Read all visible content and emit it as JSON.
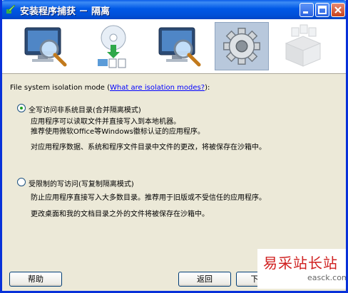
{
  "window": {
    "title": "安装程序捕获 － 隔离"
  },
  "steps": [
    {
      "name": "monitor-search",
      "active": false
    },
    {
      "name": "disc-install",
      "active": false
    },
    {
      "name": "monitor-search-2",
      "active": false
    },
    {
      "name": "settings-gear",
      "active": true
    },
    {
      "name": "package-box",
      "active": false
    }
  ],
  "isolation": {
    "heading_prefix": "File system isolation mode (",
    "heading_link": "What are isolation modes?",
    "heading_suffix": "):",
    "option1": {
      "label": "全写访问非系统目录(合并隔离模式)",
      "desc1": "应用程序可以读取文件并直接写入到本地机器。",
      "desc2": "推荐使用微软Office等Windows徽标认证的应用程序。",
      "desc3": "对应用程序数据、系统和程序文件目录中文件的更改，将被保存在沙箱中。",
      "selected": true
    },
    "option2": {
      "label": "受限制的写访问(写复制隔离模式)",
      "desc1": "防止应用程序直接写入大多数目录。推荐用于旧版或不受信任的应用程序。",
      "desc2": "更改桌面和我的文档目录之外的文件将被保存在沙箱中。",
      "selected": false
    }
  },
  "buttons": {
    "help": "帮助",
    "back": "返回",
    "next": "下一步"
  },
  "watermark": {
    "text": "易采站长站",
    "sub": "easck.com"
  }
}
